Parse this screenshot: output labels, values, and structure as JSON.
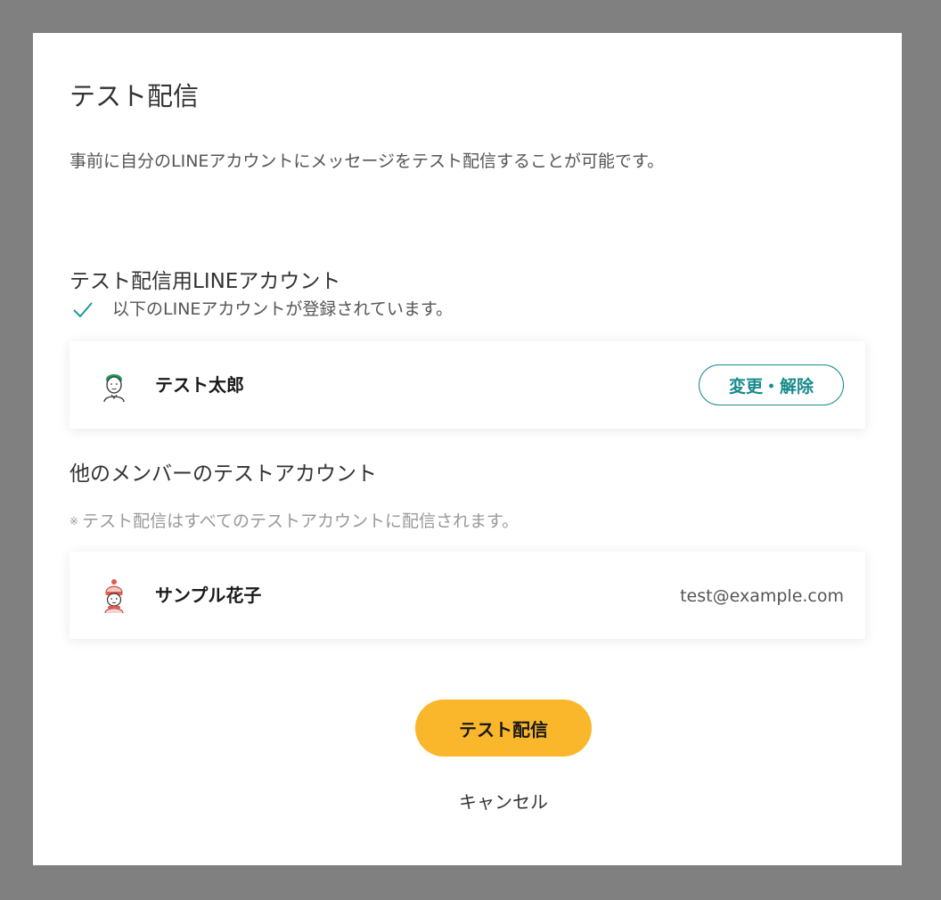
{
  "dialog": {
    "title": "テスト配信",
    "description": "事前に自分のLINEアカウントにメッセージをテスト配信することが可能です。"
  },
  "own_account": {
    "heading": "テスト配信用LINEアカウント",
    "registered_message": "以下のLINEアカウントが登録されています。",
    "check_color": "#1a9a9e",
    "user": {
      "name": "テスト太郎",
      "avatar_icon": "avatar-man-green-hair-icon"
    },
    "change_button_label": "変更・解除",
    "accent_color": "#1a8a8d"
  },
  "members": {
    "heading": "他のメンバーのテストアカウント",
    "note_mark": "※",
    "note": "テスト配信はすべてのテストアカウントに配信されます。",
    "items": [
      {
        "name": "サンプル花子",
        "email": "test@example.com",
        "avatar_icon": "avatar-woman-winter-hat-icon"
      }
    ]
  },
  "actions": {
    "primary_label": "テスト配信",
    "primary_color": "#fbb72b",
    "cancel_label": "キャンセル"
  }
}
